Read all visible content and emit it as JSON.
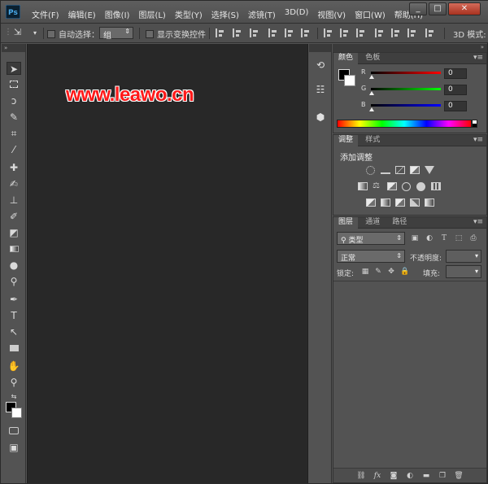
{
  "app": {
    "brand_colors": {
      "menu": "#535353",
      "canvas": "#282828",
      "watermark": "#ff1a1a"
    }
  },
  "menu": {
    "items": [
      "文件(F)",
      "编辑(E)",
      "图像(I)",
      "图层(L)",
      "类型(Y)",
      "选择(S)",
      "滤镜(T)",
      "3D(D)",
      "视图(V)",
      "窗口(W)",
      "帮助(H)"
    ]
  },
  "window": {
    "minimize": "_",
    "maximize": "□",
    "close": "✕"
  },
  "options": {
    "auto_select_label": "自动选择：",
    "auto_select_value": "组",
    "show_transform_label": "显示变换控件",
    "mode_3d_label": "3D 模式:"
  },
  "canvas": {
    "watermark": "www.leawo.cn"
  },
  "color_panel": {
    "tabs": [
      "颜色",
      "色板"
    ],
    "sliders": [
      {
        "label": "R",
        "value": "0",
        "gradient": "linear-gradient(90deg,#000,#ff0000)"
      },
      {
        "label": "G",
        "value": "0",
        "gradient": "linear-gradient(90deg,#000,#00ff00)"
      },
      {
        "label": "B",
        "value": "0",
        "gradient": "linear-gradient(90deg,#000,#0000ff)"
      }
    ]
  },
  "adjust_panel": {
    "tabs": [
      "调整",
      "样式"
    ],
    "title": "添加调整"
  },
  "layers_panel": {
    "tabs": [
      "图层",
      "通道",
      "路径"
    ],
    "filter_label": "类型",
    "blend_mode": "正常",
    "opacity_label": "不透明度:",
    "lock_label": "锁定:",
    "fill_label": "填充:"
  }
}
